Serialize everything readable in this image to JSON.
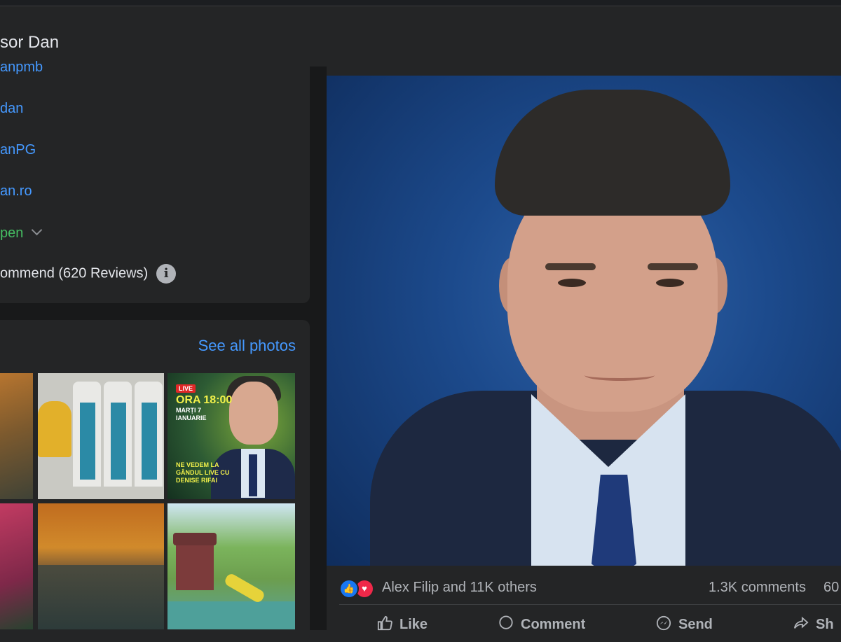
{
  "header": {
    "title": "sor Dan"
  },
  "intro": {
    "links": [
      "anpmb",
      "dan",
      "anPG",
      "an.ro"
    ],
    "status": "pen",
    "recommend": "ommend (620 Reviews)"
  },
  "photos": {
    "see_all": "See all photos",
    "live_thumb": {
      "tag": "LIVE",
      "time": "ORA 18:00",
      "date": "MARȚI 7 IANUARIE",
      "text": "NE VEDEM LA GÂNDUL LIVE CU DENISE RIFAI"
    }
  },
  "post": {
    "reactions_text": "Alex Filip and 11K others",
    "comments": "1.3K comments",
    "shares": "60",
    "actions": {
      "like": "Like",
      "comment": "Comment",
      "send": "Send",
      "share": "Sh"
    }
  },
  "colors": {
    "link": "#4599ff",
    "open": "#45bd62",
    "like": "#1877f2",
    "love": "#f02849"
  }
}
